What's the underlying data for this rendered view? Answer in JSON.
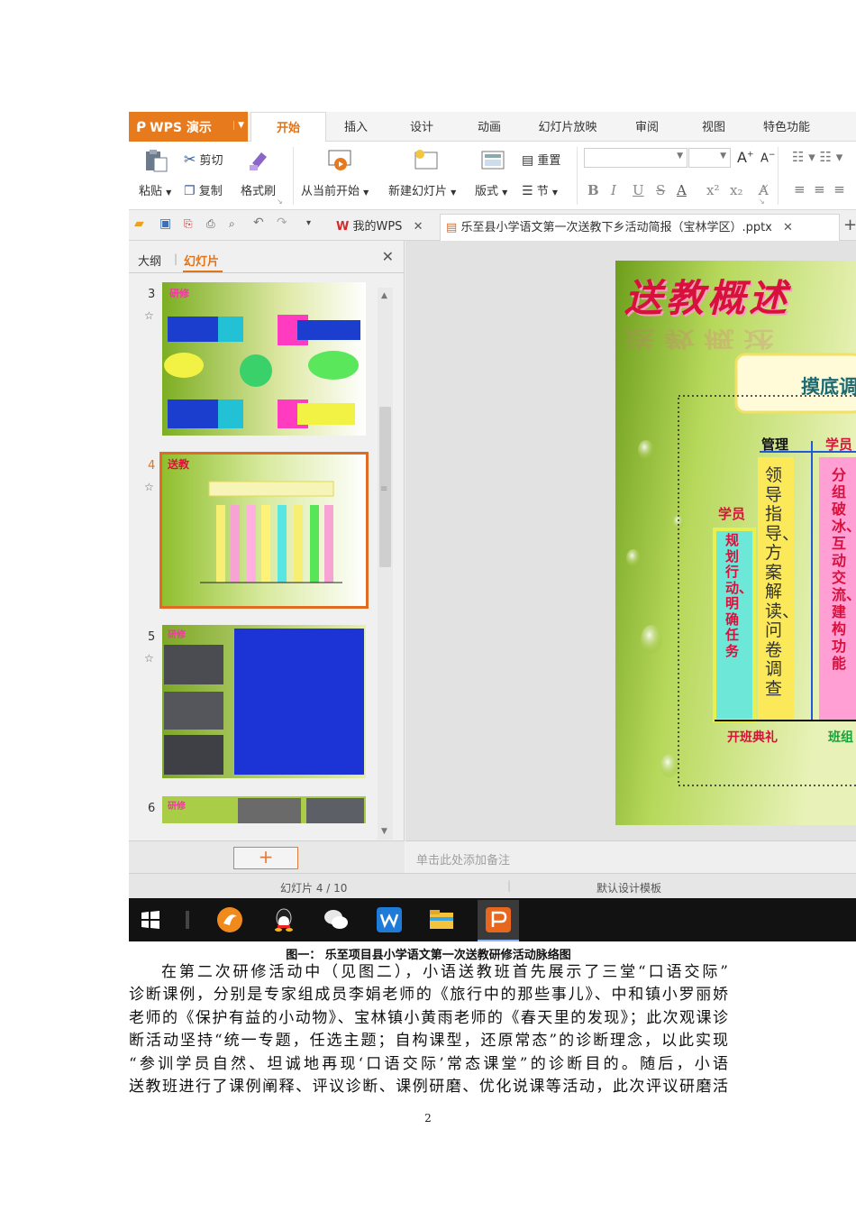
{
  "app": {
    "name": "WPS 演示",
    "tabs": [
      "开始",
      "插入",
      "设计",
      "动画",
      "幻灯片放映",
      "审阅",
      "视图",
      "特色功能"
    ],
    "active_tab": "开始"
  },
  "ribbon": {
    "paste": "粘贴",
    "cut": "剪切",
    "copy": "复制",
    "format_painter": "格式刷",
    "from_current": "从当前开始",
    "new_slide": "新建幻灯片",
    "layout": "版式",
    "reset": "重置",
    "section": "节",
    "font_name": "",
    "font_size": "",
    "bold": "B",
    "italic": "I",
    "underline": "U",
    "strike": "S",
    "font_color": "A",
    "superscript": "x²",
    "subscript": "x₂"
  },
  "document_tabs": [
    {
      "label": "我的WPS"
    },
    {
      "label": "乐至县小学语文第一次送教下乡活动简报（宝林学区）.pptx"
    }
  ],
  "left_pane": {
    "outline_tab": "大纲",
    "slides_tab": "幻灯片",
    "slide_numbers": [
      "3",
      "4",
      "5",
      "6"
    ],
    "selected_slide": "4"
  },
  "slide": {
    "title": "送教概述",
    "banner": "摸底调",
    "col_manage": "管理",
    "col_student": "学员",
    "col_student2": "学员",
    "manage_text": "领导指导、方案解读、问卷调查",
    "student_text": "规划行动、明确任务",
    "student_text2": "分组破冰、互动交流、建构功能",
    "footer_left": "开班典礼",
    "footer_right": "班组"
  },
  "notes_placeholder": "单击此处添加备注",
  "status": {
    "slide_counter": "幻灯片 4 / 10",
    "template": "默认设计模板"
  },
  "caption": "图一： 乐至项目县小学语文第一次送教研修活动脉络图",
  "paragraph_lines": [
    "在第二次研修活动中（见图二），小语送教班首先展示了三堂“口语交际”",
    "诊断课例，分别是专家组成员李娟老师的《旅行中的那些事儿》、中和镇小罗丽娇",
    "老师的《保护有益的小动物》、宝林镇小黄雨老师的《春天里的发现》；此次观课诊",
    "断活动坚持“统一专题，任选主题；自构课型，还原常态”的诊断理念，以此实现",
    "“参训学员自然、坦诚地再现‘口语交际’常态课堂”的诊断目的。随后，小语",
    "送教班进行了课例阐释、评议诊断、课例研磨、优化说课等活动，此次评议研磨活"
  ],
  "page_number": "2",
  "colors": {
    "accent": "#e87a1e",
    "slide_green": "#9fc83c",
    "title_red": "#d8103c"
  }
}
